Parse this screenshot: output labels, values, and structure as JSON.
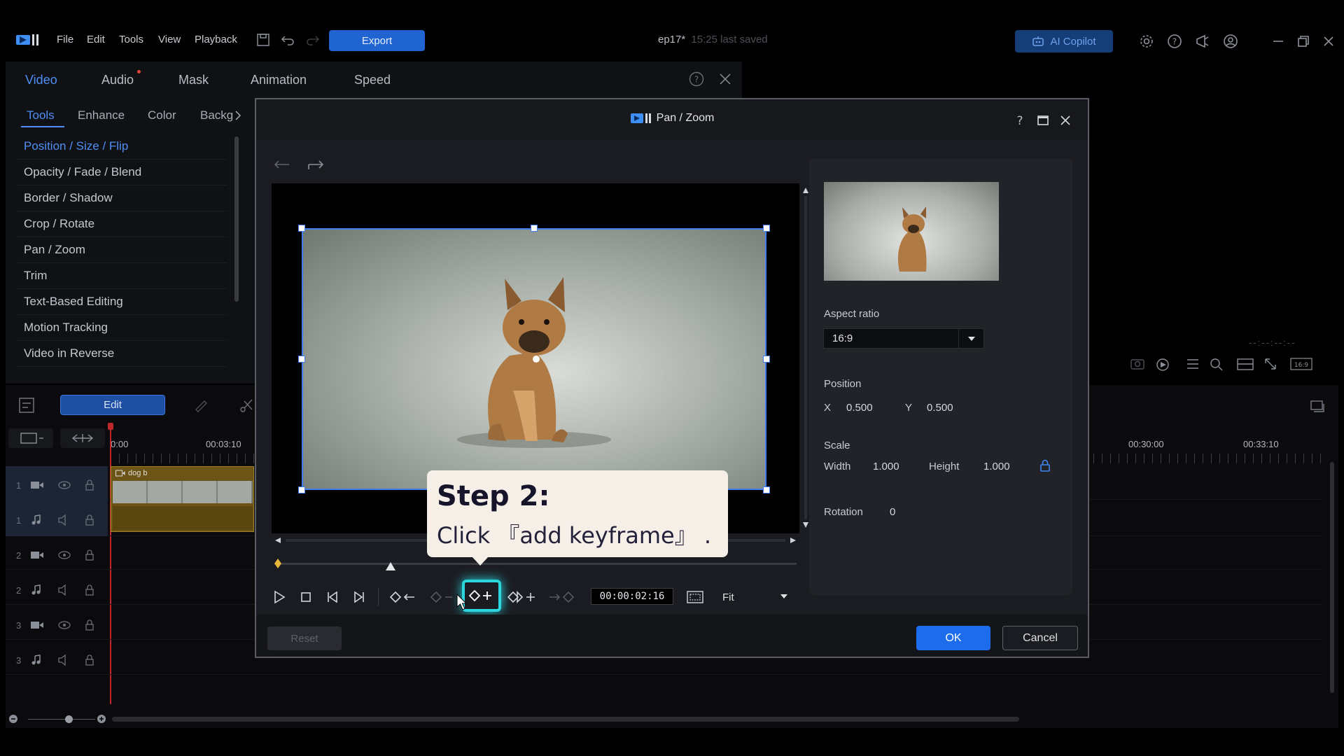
{
  "app": {
    "menu": [
      "File",
      "Edit",
      "Tools",
      "View",
      "Playback"
    ],
    "export_label": "Export",
    "project_name": "ep17*",
    "project_saved": "15:25 last saved",
    "ai_copilot_label": "AI Copilot"
  },
  "panel": {
    "main_tabs": [
      "Video",
      "Audio",
      "Mask",
      "Animation",
      "Speed"
    ],
    "sub_tabs": [
      "Tools",
      "Enhance",
      "Color",
      "Backg"
    ],
    "tools": [
      "Position / Size / Flip",
      "Opacity / Fade / Blend",
      "Border / Shadow",
      "Crop / Rotate",
      "Pan / Zoom",
      "Trim",
      "Text-Based Editing",
      "Motion Tracking",
      "Video in Reverse"
    ]
  },
  "timeline": {
    "edit_label": "Edit",
    "times": [
      "0:00",
      "00:03:10",
      "00:30:00",
      "00:33:10"
    ],
    "clip_name": "dog b",
    "track_numbers": [
      "1",
      "1",
      "2",
      "2",
      "3",
      "3"
    ],
    "time_placeholder": "--:--:--:--"
  },
  "dialog": {
    "title": "Pan / Zoom",
    "aspect_ratio_label": "Aspect ratio",
    "aspect_ratio_value": "16:9",
    "position_label": "Position",
    "x_label": "X",
    "x_value": "0.500",
    "y_label": "Y",
    "y_value": "0.500",
    "scale_label": "Scale",
    "width_label": "Width",
    "width_value": "1.000",
    "height_label": "Height",
    "height_value": "1.000",
    "rotation_label": "Rotation",
    "rotation_value": "0",
    "timecode": "00:00:02:16",
    "fit_value": "Fit",
    "reset_label": "Reset",
    "ok_label": "OK",
    "cancel_label": "Cancel"
  },
  "tooltip": {
    "title": "Step 2:",
    "body": "Click 『add keyframe』 ."
  },
  "colors": {
    "accent": "#1c6cec",
    "highlight": "#2bd6df",
    "clip": "#6b5415"
  }
}
